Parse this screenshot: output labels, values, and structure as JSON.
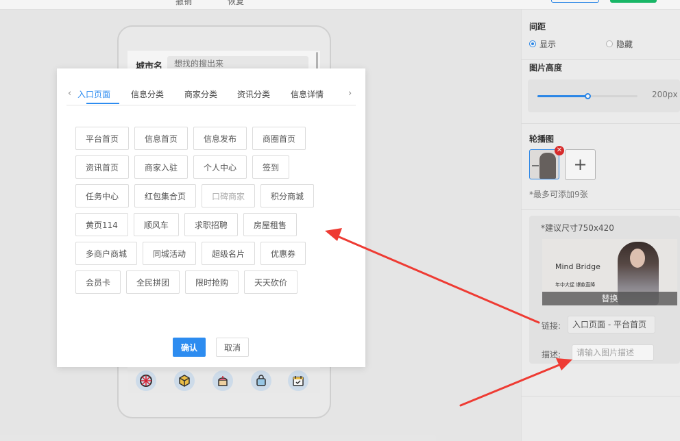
{
  "topbar": {
    "undo_label": "撤销",
    "redo_label": "恢复"
  },
  "phone": {
    "city_label": "城市名",
    "search_placeholder": "想找的搜出来",
    "bottom_icons": [
      "wheel-icon",
      "cube-icon",
      "cake-icon",
      "bag-icon",
      "calendar-icon"
    ]
  },
  "panel": {
    "spacing_label": "间距",
    "spacing_options": [
      "显示",
      "隐藏"
    ],
    "spacing_selected": "显示",
    "image_height_label": "图片高度",
    "image_height_value": "200px",
    "image_height_level_percent": 50,
    "carousel_label": "轮播图",
    "carousel_hint": "*最多可添加9张",
    "size_hint": "*建议尺寸750x420",
    "banner_title": "Mind Bridge",
    "banner_subtitle": "年中大促 爆款直降",
    "replace_label": "替换",
    "link_label": "链接:",
    "link_value": "入口页面 - 平台首页",
    "desc_label": "描述:",
    "desc_placeholder": "请输入图片描述"
  },
  "modal": {
    "tabs": [
      "入口页面",
      "信息分类",
      "商家分类",
      "资讯分类",
      "信息详情"
    ],
    "active_tab": "入口页面",
    "rows": [
      [
        "平台首页",
        "信息首页",
        "信息发布",
        "商圈首页"
      ],
      [
        "资讯首页",
        "商家入驻",
        "个人中心",
        "签到"
      ],
      [
        "任务中心",
        "红包集合页",
        "口碑商家",
        "积分商城"
      ],
      [
        "黄页114",
        "顺风车",
        "求职招聘",
        "房屋租售"
      ],
      [
        "多商户商城",
        "同城活动",
        "超级名片",
        "优惠券"
      ],
      [
        "会员卡",
        "全民拼团",
        "限时抢购",
        "天天砍价"
      ]
    ],
    "disabled_item": "口碑商家",
    "confirm_label": "确认",
    "cancel_label": "取消"
  },
  "colors": {
    "accent": "#2d8cf0",
    "arrow": "#ee3b33",
    "delete_badge": "#e02d2d"
  }
}
